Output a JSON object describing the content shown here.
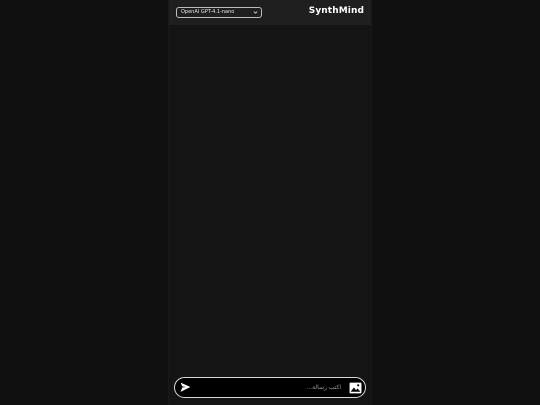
{
  "header": {
    "model_select": "OpenAI GPT-4.1-nano",
    "brand": "SynthMind"
  },
  "composer": {
    "placeholder": "اكتب رسالة..."
  },
  "icons": {
    "dropdown": "chevron-down-icon",
    "send": "send-icon",
    "attach_image": "image-icon"
  }
}
